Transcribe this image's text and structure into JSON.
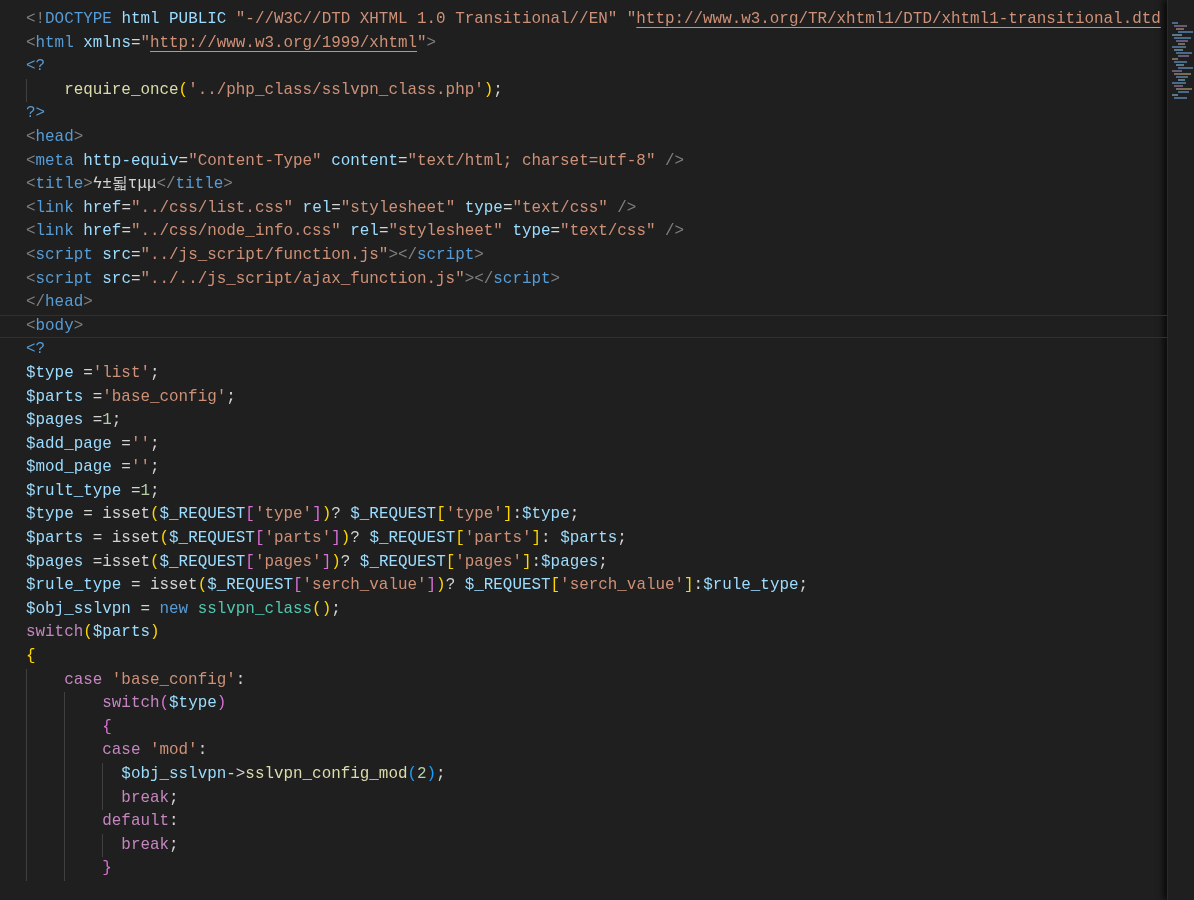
{
  "editor": {
    "lines": [
      {
        "current": false,
        "tokens": [
          {
            "kind": "punct",
            "text": "<!"
          },
          {
            "kind": "tag",
            "text": "DOCTYPE "
          },
          {
            "kind": "attr",
            "text": "html PUBLIC "
          },
          {
            "kind": "string",
            "text": "\"-//W3C//DTD XHTML 1.0 Transitional//EN\" \""
          },
          {
            "kind": "link",
            "text": "http://www.w3.org/TR/xhtml1/DTD/xhtml1-transitional.dtd"
          }
        ]
      },
      {
        "current": false,
        "tokens": [
          {
            "kind": "punct",
            "text": "<"
          },
          {
            "kind": "tag",
            "text": "html "
          },
          {
            "kind": "attr",
            "text": "xmlns"
          },
          {
            "kind": "plain",
            "text": "="
          },
          {
            "kind": "string",
            "text": "\""
          },
          {
            "kind": "link",
            "text": "http://www.w3.org/1999/xhtml"
          },
          {
            "kind": "string",
            "text": "\""
          },
          {
            "kind": "punct",
            "text": ">"
          }
        ]
      },
      {
        "current": false,
        "tokens": [
          {
            "kind": "php",
            "text": "<?"
          }
        ]
      },
      {
        "current": false,
        "tokens": [
          {
            "kind": "func",
            "text": "    require_once"
          },
          {
            "kind": "br1",
            "text": "("
          },
          {
            "kind": "string",
            "text": "'../php_class/sslvpn_class.php'"
          },
          {
            "kind": "br1",
            "text": ")"
          },
          {
            "kind": "plain",
            "text": ";"
          }
        ]
      },
      {
        "current": false,
        "tokens": [
          {
            "kind": "php",
            "text": "?>"
          }
        ]
      },
      {
        "current": false,
        "tokens": [
          {
            "kind": "punct",
            "text": "<"
          },
          {
            "kind": "tag",
            "text": "head"
          },
          {
            "kind": "punct",
            "text": ">"
          }
        ]
      },
      {
        "current": false,
        "tokens": [
          {
            "kind": "punct",
            "text": "<"
          },
          {
            "kind": "tag",
            "text": "meta "
          },
          {
            "kind": "attr",
            "text": "http-equiv"
          },
          {
            "kind": "plain",
            "text": "="
          },
          {
            "kind": "string",
            "text": "\"Content-Type\" "
          },
          {
            "kind": "attr",
            "text": "content"
          },
          {
            "kind": "plain",
            "text": "="
          },
          {
            "kind": "string",
            "text": "\"text/html; charset=utf-8\" "
          },
          {
            "kind": "punct",
            "text": "/>"
          }
        ]
      },
      {
        "current": false,
        "tokens": [
          {
            "kind": "punct",
            "text": "<"
          },
          {
            "kind": "tag",
            "text": "title"
          },
          {
            "kind": "punct",
            "text": ">"
          },
          {
            "kind": "plain",
            "text": "ϟ±됣τμμ"
          },
          {
            "kind": "punct",
            "text": "</"
          },
          {
            "kind": "tag",
            "text": "title"
          },
          {
            "kind": "punct",
            "text": ">"
          }
        ]
      },
      {
        "current": false,
        "tokens": [
          {
            "kind": "punct",
            "text": "<"
          },
          {
            "kind": "tag",
            "text": "link "
          },
          {
            "kind": "attr",
            "text": "href"
          },
          {
            "kind": "plain",
            "text": "="
          },
          {
            "kind": "string",
            "text": "\"../css/list.css\" "
          },
          {
            "kind": "attr",
            "text": "rel"
          },
          {
            "kind": "plain",
            "text": "="
          },
          {
            "kind": "string",
            "text": "\"stylesheet\" "
          },
          {
            "kind": "attr",
            "text": "type"
          },
          {
            "kind": "plain",
            "text": "="
          },
          {
            "kind": "string",
            "text": "\"text/css\" "
          },
          {
            "kind": "punct",
            "text": "/>"
          }
        ]
      },
      {
        "current": false,
        "tokens": [
          {
            "kind": "punct",
            "text": "<"
          },
          {
            "kind": "tag",
            "text": "link "
          },
          {
            "kind": "attr",
            "text": "href"
          },
          {
            "kind": "plain",
            "text": "="
          },
          {
            "kind": "string",
            "text": "\"../css/node_info.css\" "
          },
          {
            "kind": "attr",
            "text": "rel"
          },
          {
            "kind": "plain",
            "text": "="
          },
          {
            "kind": "string",
            "text": "\"stylesheet\" "
          },
          {
            "kind": "attr",
            "text": "type"
          },
          {
            "kind": "plain",
            "text": "="
          },
          {
            "kind": "string",
            "text": "\"text/css\" "
          },
          {
            "kind": "punct",
            "text": "/>"
          }
        ]
      },
      {
        "current": false,
        "tokens": [
          {
            "kind": "punct",
            "text": "<"
          },
          {
            "kind": "tag",
            "text": "script "
          },
          {
            "kind": "attr",
            "text": "src"
          },
          {
            "kind": "plain",
            "text": "="
          },
          {
            "kind": "string",
            "text": "\"../js_script/function.js\""
          },
          {
            "kind": "punct",
            "text": "></"
          },
          {
            "kind": "tag",
            "text": "script"
          },
          {
            "kind": "punct",
            "text": ">"
          }
        ]
      },
      {
        "current": false,
        "tokens": [
          {
            "kind": "punct",
            "text": "<"
          },
          {
            "kind": "tag",
            "text": "script "
          },
          {
            "kind": "attr",
            "text": "src"
          },
          {
            "kind": "plain",
            "text": "="
          },
          {
            "kind": "string",
            "text": "\"../../js_script/ajax_function.js\""
          },
          {
            "kind": "punct",
            "text": "></"
          },
          {
            "kind": "tag",
            "text": "script"
          },
          {
            "kind": "punct",
            "text": ">"
          }
        ]
      },
      {
        "current": false,
        "tokens": [
          {
            "kind": "punct",
            "text": "</"
          },
          {
            "kind": "tag",
            "text": "head"
          },
          {
            "kind": "punct",
            "text": ">"
          }
        ]
      },
      {
        "current": true,
        "tokens": [
          {
            "kind": "punct",
            "text": "<"
          },
          {
            "kind": "tag",
            "text": "body"
          },
          {
            "kind": "punct",
            "text": ">"
          }
        ]
      },
      {
        "current": false,
        "tokens": [
          {
            "kind": "php",
            "text": "<?"
          }
        ]
      },
      {
        "current": false,
        "tokens": [
          {
            "kind": "var",
            "text": "$type"
          },
          {
            "kind": "plain",
            "text": " ="
          },
          {
            "kind": "string",
            "text": "'list'"
          },
          {
            "kind": "plain",
            "text": ";"
          }
        ]
      },
      {
        "current": false,
        "tokens": [
          {
            "kind": "var",
            "text": "$parts"
          },
          {
            "kind": "plain",
            "text": " ="
          },
          {
            "kind": "string",
            "text": "'base_config'"
          },
          {
            "kind": "plain",
            "text": ";"
          }
        ]
      },
      {
        "current": false,
        "tokens": [
          {
            "kind": "var",
            "text": "$pages"
          },
          {
            "kind": "plain",
            "text": " ="
          },
          {
            "kind": "number",
            "text": "1"
          },
          {
            "kind": "plain",
            "text": ";"
          }
        ]
      },
      {
        "current": false,
        "tokens": [
          {
            "kind": "var",
            "text": "$add_page"
          },
          {
            "kind": "plain",
            "text": " ="
          },
          {
            "kind": "string",
            "text": "''"
          },
          {
            "kind": "plain",
            "text": ";"
          }
        ]
      },
      {
        "current": false,
        "tokens": [
          {
            "kind": "var",
            "text": "$mod_page"
          },
          {
            "kind": "plain",
            "text": " ="
          },
          {
            "kind": "string",
            "text": "''"
          },
          {
            "kind": "plain",
            "text": ";"
          }
        ]
      },
      {
        "current": false,
        "tokens": [
          {
            "kind": "var",
            "text": "$rult_type"
          },
          {
            "kind": "plain",
            "text": " ="
          },
          {
            "kind": "number",
            "text": "1"
          },
          {
            "kind": "plain",
            "text": ";"
          }
        ]
      },
      {
        "current": false,
        "tokens": [
          {
            "kind": "var",
            "text": "$type"
          },
          {
            "kind": "plain",
            "text": " = isset"
          },
          {
            "kind": "br1",
            "text": "("
          },
          {
            "kind": "var",
            "text": "$_REQUEST"
          },
          {
            "kind": "br2",
            "text": "["
          },
          {
            "kind": "string",
            "text": "'type'"
          },
          {
            "kind": "br2",
            "text": "]"
          },
          {
            "kind": "br1",
            "text": ")"
          },
          {
            "kind": "plain",
            "text": "? "
          },
          {
            "kind": "var",
            "text": "$_REQUEST"
          },
          {
            "kind": "br1",
            "text": "["
          },
          {
            "kind": "string",
            "text": "'type'"
          },
          {
            "kind": "br1",
            "text": "]"
          },
          {
            "kind": "plain",
            "text": ":"
          },
          {
            "kind": "var",
            "text": "$type"
          },
          {
            "kind": "plain",
            "text": ";"
          }
        ]
      },
      {
        "current": false,
        "tokens": [
          {
            "kind": "var",
            "text": "$parts"
          },
          {
            "kind": "plain",
            "text": " = isset"
          },
          {
            "kind": "br1",
            "text": "("
          },
          {
            "kind": "var",
            "text": "$_REQUEST"
          },
          {
            "kind": "br2",
            "text": "["
          },
          {
            "kind": "string",
            "text": "'parts'"
          },
          {
            "kind": "br2",
            "text": "]"
          },
          {
            "kind": "br1",
            "text": ")"
          },
          {
            "kind": "plain",
            "text": "? "
          },
          {
            "kind": "var",
            "text": "$_REQUEST"
          },
          {
            "kind": "br1",
            "text": "["
          },
          {
            "kind": "string",
            "text": "'parts'"
          },
          {
            "kind": "br1",
            "text": "]"
          },
          {
            "kind": "plain",
            "text": ": "
          },
          {
            "kind": "var",
            "text": "$parts"
          },
          {
            "kind": "plain",
            "text": ";"
          }
        ]
      },
      {
        "current": false,
        "tokens": [
          {
            "kind": "var",
            "text": "$pages"
          },
          {
            "kind": "plain",
            "text": " =isset"
          },
          {
            "kind": "br1",
            "text": "("
          },
          {
            "kind": "var",
            "text": "$_REQUEST"
          },
          {
            "kind": "br2",
            "text": "["
          },
          {
            "kind": "string",
            "text": "'pages'"
          },
          {
            "kind": "br2",
            "text": "]"
          },
          {
            "kind": "br1",
            "text": ")"
          },
          {
            "kind": "plain",
            "text": "? "
          },
          {
            "kind": "var",
            "text": "$_REQUEST"
          },
          {
            "kind": "br1",
            "text": "["
          },
          {
            "kind": "string",
            "text": "'pages'"
          },
          {
            "kind": "br1",
            "text": "]"
          },
          {
            "kind": "plain",
            "text": ":"
          },
          {
            "kind": "var",
            "text": "$pages"
          },
          {
            "kind": "plain",
            "text": ";"
          }
        ]
      },
      {
        "current": false,
        "tokens": [
          {
            "kind": "var",
            "text": "$rule_type"
          },
          {
            "kind": "plain",
            "text": " = isset"
          },
          {
            "kind": "br1",
            "text": "("
          },
          {
            "kind": "var",
            "text": "$_REQUEST"
          },
          {
            "kind": "br2",
            "text": "["
          },
          {
            "kind": "string",
            "text": "'serch_value'"
          },
          {
            "kind": "br2",
            "text": "]"
          },
          {
            "kind": "br1",
            "text": ")"
          },
          {
            "kind": "plain",
            "text": "? "
          },
          {
            "kind": "var",
            "text": "$_REQUEST"
          },
          {
            "kind": "br1",
            "text": "["
          },
          {
            "kind": "string",
            "text": "'serch_value'"
          },
          {
            "kind": "br1",
            "text": "]"
          },
          {
            "kind": "plain",
            "text": ":"
          },
          {
            "kind": "var",
            "text": "$rule_type"
          },
          {
            "kind": "plain",
            "text": ";"
          }
        ]
      },
      {
        "current": false,
        "tokens": [
          {
            "kind": "var",
            "text": "$obj_sslvpn"
          },
          {
            "kind": "plain",
            "text": " = "
          },
          {
            "kind": "storage",
            "text": "new "
          },
          {
            "kind": "class",
            "text": "sslvpn_class"
          },
          {
            "kind": "br1",
            "text": "()"
          },
          {
            "kind": "plain",
            "text": ";"
          }
        ]
      },
      {
        "current": false,
        "tokens": [
          {
            "kind": "keyword",
            "text": "switch"
          },
          {
            "kind": "br1",
            "text": "("
          },
          {
            "kind": "var",
            "text": "$parts"
          },
          {
            "kind": "br1",
            "text": ")"
          }
        ]
      },
      {
        "current": false,
        "tokens": [
          {
            "kind": "br1",
            "text": "{"
          }
        ]
      },
      {
        "current": false,
        "tokens": [
          {
            "kind": "keyword",
            "text": "    case "
          },
          {
            "kind": "string",
            "text": "'base_config'"
          },
          {
            "kind": "plain",
            "text": ":"
          }
        ]
      },
      {
        "current": false,
        "tokens": [
          {
            "kind": "keyword",
            "text": "        switch"
          },
          {
            "kind": "br2",
            "text": "("
          },
          {
            "kind": "var",
            "text": "$type"
          },
          {
            "kind": "br2",
            "text": ")"
          }
        ]
      },
      {
        "current": false,
        "tokens": [
          {
            "kind": "br2",
            "text": "        {"
          }
        ]
      },
      {
        "current": false,
        "tokens": [
          {
            "kind": "keyword",
            "text": "        case "
          },
          {
            "kind": "string",
            "text": "'mod'"
          },
          {
            "kind": "plain",
            "text": ":"
          }
        ]
      },
      {
        "current": false,
        "tokens": [
          {
            "kind": "var",
            "text": "          $obj_sslvpn"
          },
          {
            "kind": "plain",
            "text": "->"
          },
          {
            "kind": "func",
            "text": "sslvpn_config_mod"
          },
          {
            "kind": "br3",
            "text": "("
          },
          {
            "kind": "number",
            "text": "2"
          },
          {
            "kind": "br3",
            "text": ")"
          },
          {
            "kind": "plain",
            "text": ";"
          }
        ]
      },
      {
        "current": false,
        "tokens": [
          {
            "kind": "keyword",
            "text": "          break"
          },
          {
            "kind": "plain",
            "text": ";"
          }
        ]
      },
      {
        "current": false,
        "tokens": [
          {
            "kind": "keyword",
            "text": "        default"
          },
          {
            "kind": "plain",
            "text": ":"
          }
        ]
      },
      {
        "current": false,
        "tokens": [
          {
            "kind": "keyword",
            "text": "          break"
          },
          {
            "kind": "plain",
            "text": ";"
          }
        ]
      },
      {
        "current": false,
        "tokens": [
          {
            "kind": "br2",
            "text": "        }"
          }
        ]
      }
    ]
  }
}
